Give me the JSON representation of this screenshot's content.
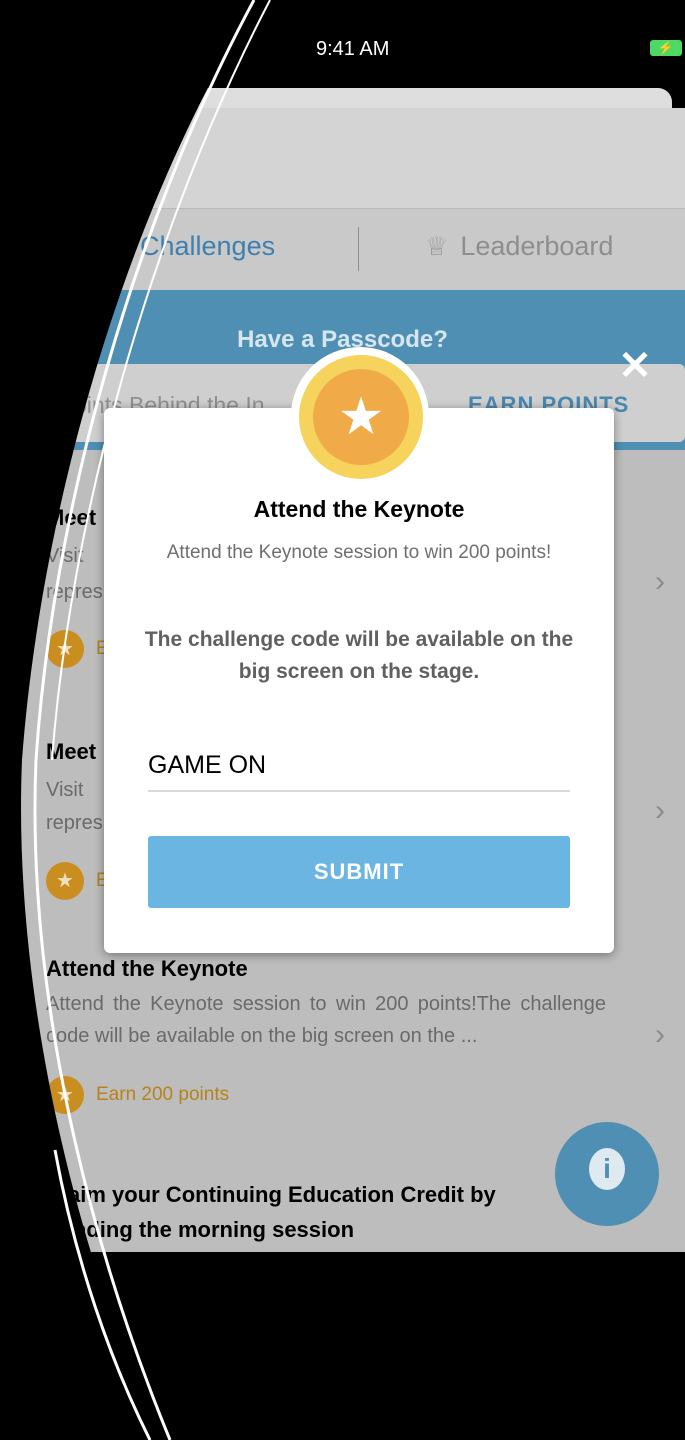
{
  "status_bar": {
    "time": "9:41 AM"
  },
  "tabs": {
    "challenges": "Challenges",
    "leaderboard": "Leaderboard"
  },
  "banner": {
    "title": "Have a Passcode?",
    "placeholder": "oints Behind the In",
    "earn_button": "EARN POINTS"
  },
  "list": [
    {
      "title": "Meet",
      "desc_line1": "Visit",
      "desc_line2": "repres",
      "earn": "E"
    },
    {
      "title": "Meet",
      "desc_line1": "Visit",
      "desc_line2": "repres",
      "earn": "E"
    },
    {
      "title": "Attend the Keynote",
      "desc": "Attend the Keynote session to win 200 points!The challenge code will be available on the big screen on the ...",
      "earn": "Earn 200 points"
    },
    {
      "title_line1": "Claim your Continuing Education Credit by",
      "title_line2": "ttending the morning session"
    }
  ],
  "modal": {
    "title": "Attend the Keynote",
    "desc": "Attend the Keynote session to win 200 points!",
    "note": "The challenge code will be available on the big screen on the stage.",
    "input_value": "GAME ON",
    "submit": "SUBMIT"
  },
  "icons": {
    "close": "close-icon",
    "star": "star-icon",
    "trophy": "trophy-icon",
    "info": "info-icon",
    "chevron": "chevron-right-icon"
  },
  "colors": {
    "accent": "#4f8fb3",
    "submit": "#6bb5e2",
    "badge_outer": "#f6d35c",
    "badge_inner": "#f0ab48",
    "earn": "#b5831c"
  }
}
